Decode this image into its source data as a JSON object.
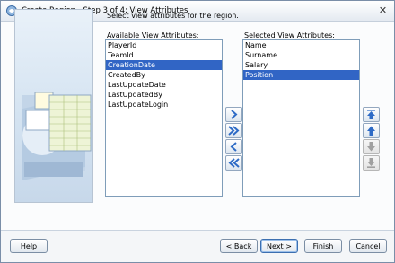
{
  "window": {
    "title": "Create Region - Step 3 of 4: View Attributes"
  },
  "instruction": "Select view attributes for the region.",
  "available": {
    "label_prefix": "A",
    "label_rest": "vailable View Attributes:",
    "items": [
      "PlayerId",
      "TeamId",
      "CreationDate",
      "CreatedBy",
      "LastUpdateDate",
      "LastUpdatedBy",
      "LastUpdateLogin"
    ],
    "selected_item": "CreationDate"
  },
  "selected": {
    "label_prefix": "S",
    "label_rest": "elected View Attributes:",
    "items": [
      "Name",
      "Surname",
      "Salary",
      "Position"
    ],
    "selected_item": "Position"
  },
  "buttons": {
    "help_prefix": "H",
    "help_rest": "elp",
    "back_prefix": "< ",
    "back_mn": "B",
    "back_rest": "ack",
    "next_mn": "N",
    "next_rest": "ext >",
    "finish_mn": "F",
    "finish_rest": "inish",
    "cancel": "Cancel"
  },
  "colors": {
    "selection": "#3165c5",
    "arrow_blue": "#2e6bc6",
    "disabled": "#a0a0a0"
  }
}
